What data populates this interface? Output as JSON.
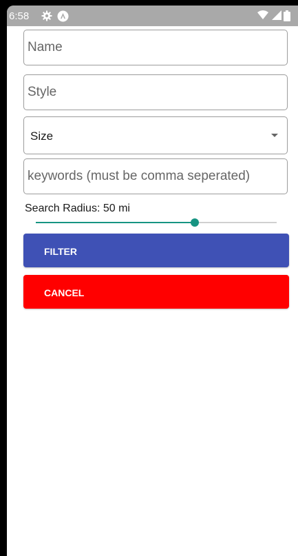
{
  "status_bar": {
    "time": "6:58",
    "icons": [
      "settings-icon",
      "app-badge-icon",
      "wifi-icon",
      "signal-icon",
      "battery-icon"
    ]
  },
  "form": {
    "name_placeholder": "Name",
    "style_placeholder": "Style",
    "size_label": "Size",
    "keywords_placeholder": "keywords (must be comma seperated)",
    "radius_label": "Search Radius: 50 mi",
    "slider_fraction": 0.66
  },
  "buttons": {
    "filter_label": "FILTER",
    "cancel_label": "CANCEL"
  },
  "colors": {
    "accent": "#179482",
    "filter_bg": "#3f51b5",
    "cancel_bg": "#ff0000",
    "status_bar": "#a9a9a9"
  }
}
